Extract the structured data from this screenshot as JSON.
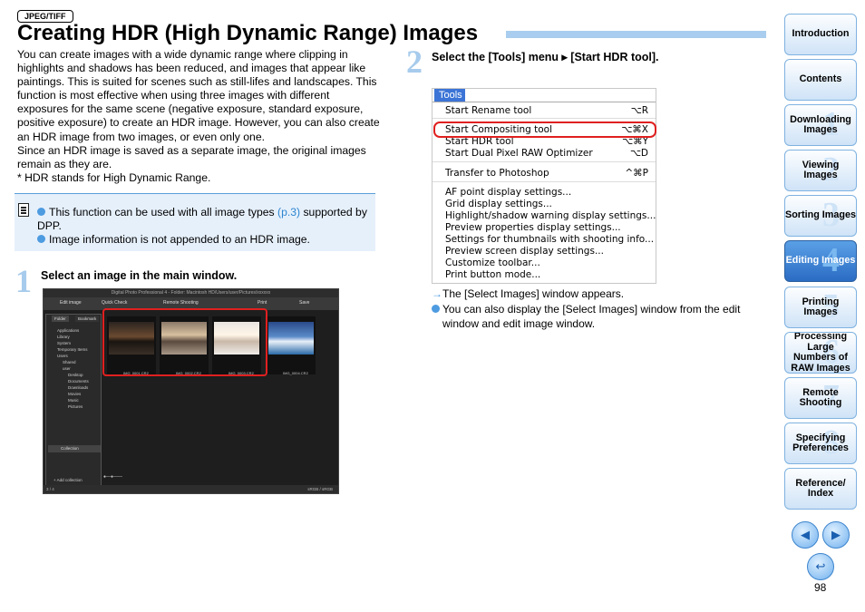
{
  "tag": "JPEG/TIFF",
  "title": "Creating HDR (High Dynamic Range) Images",
  "intro": [
    "You can create images with a wide dynamic range where clipping in highlights and shadows has been reduced, and images that appear like paintings. This is suited for scenes such as still-lifes and landscapes. This function is most effective when using three images with different exposures for the same scene (negative exposure, standard exposure, positive exposure) to create an HDR image. However, you can also create an HDR image from two images, or even only one.",
    "Since an HDR image is saved as a separate image, the original images remain as they are.",
    "* HDR stands for High Dynamic Range."
  ],
  "note": {
    "line1_pre": "This function can be used with all image types ",
    "line1_link": "(p.3)",
    "line1_post": " supported by DPP.",
    "line2": "Image information is not appended to an HDR image."
  },
  "step1": {
    "num": "1",
    "text": "Select an image in the main window."
  },
  "step2": {
    "num": "2",
    "text": "Select the [Tools] menu ▸ [Start HDR tool]."
  },
  "screenshot": {
    "window_title": "Digital Photo Professional 4 - Folder: Macintosh HD/Users/user/Pictures/xxxxxx",
    "toolbar": [
      "Edit image",
      "Quick Check",
      "Remote Shooting",
      "Print",
      "Save"
    ],
    "tabs": [
      "Folder",
      "Bookmark"
    ],
    "tree": [
      "Applications",
      "Library",
      "System",
      "Temporary Items",
      "Users",
      "Shared",
      "user",
      "Desktop",
      "Documents",
      "Downloads",
      "Movies",
      "Music",
      "Pictures"
    ],
    "collection": "Collection",
    "add_collection": "+ Add collection",
    "thumbs": [
      "IMG_0001.CR2",
      "IMG_0002.CR2",
      "IMG_0003.CR2",
      "IMG_0004.CR2"
    ],
    "status_left": "3 / 4",
    "status_right": "sRGB / sRGB"
  },
  "menu": {
    "header": "Tools",
    "items": [
      {
        "label": "Start Rename tool",
        "key": "⌥R"
      },
      {
        "label": "Start Compositing tool",
        "key": "⌥⌘X"
      },
      {
        "label": "Start HDR tool",
        "key": "⌥⌘Y"
      },
      {
        "label": "Start Dual Pixel RAW Optimizer",
        "key": "⌥D"
      },
      {
        "label": "Transfer to Photoshop",
        "key": "^⌘P"
      },
      {
        "label": "AF point display settings...",
        "key": ""
      },
      {
        "label": "Grid display settings...",
        "key": ""
      },
      {
        "label": "Highlight/shadow warning display settings...",
        "key": ""
      },
      {
        "label": "Preview properties display settings...",
        "key": ""
      },
      {
        "label": "Settings for thumbnails with shooting info...",
        "key": ""
      },
      {
        "label": "Preview screen display settings...",
        "key": ""
      },
      {
        "label": "Customize toolbar...",
        "key": ""
      },
      {
        "label": "Print button mode...",
        "key": ""
      }
    ]
  },
  "result": {
    "arrow": "→",
    "line1": "The [Select Images] window appears.",
    "line2": "You can also display the [Select Images] window from the edit window and edit image window."
  },
  "nav": [
    {
      "label": "Introduction",
      "num": ""
    },
    {
      "label": "Contents",
      "num": ""
    },
    {
      "label": "Downloading Images",
      "num": "1"
    },
    {
      "label": "Viewing Images",
      "num": "2"
    },
    {
      "label": "Sorting Images",
      "num": "3"
    },
    {
      "label": "Editing Images",
      "num": "4"
    },
    {
      "label": "Printing Images",
      "num": "5"
    },
    {
      "label": "Processing Large Numbers of RAW Images",
      "num": "6"
    },
    {
      "label": "Remote Shooting",
      "num": "7"
    },
    {
      "label": "Specifying Preferences",
      "num": "8"
    },
    {
      "label": "Reference/ Index",
      "num": ""
    }
  ],
  "page_number": "98",
  "colors": {
    "accent": "#4d9be0",
    "highlight_box": "#e02020",
    "title_bar": "#a9cdee"
  }
}
